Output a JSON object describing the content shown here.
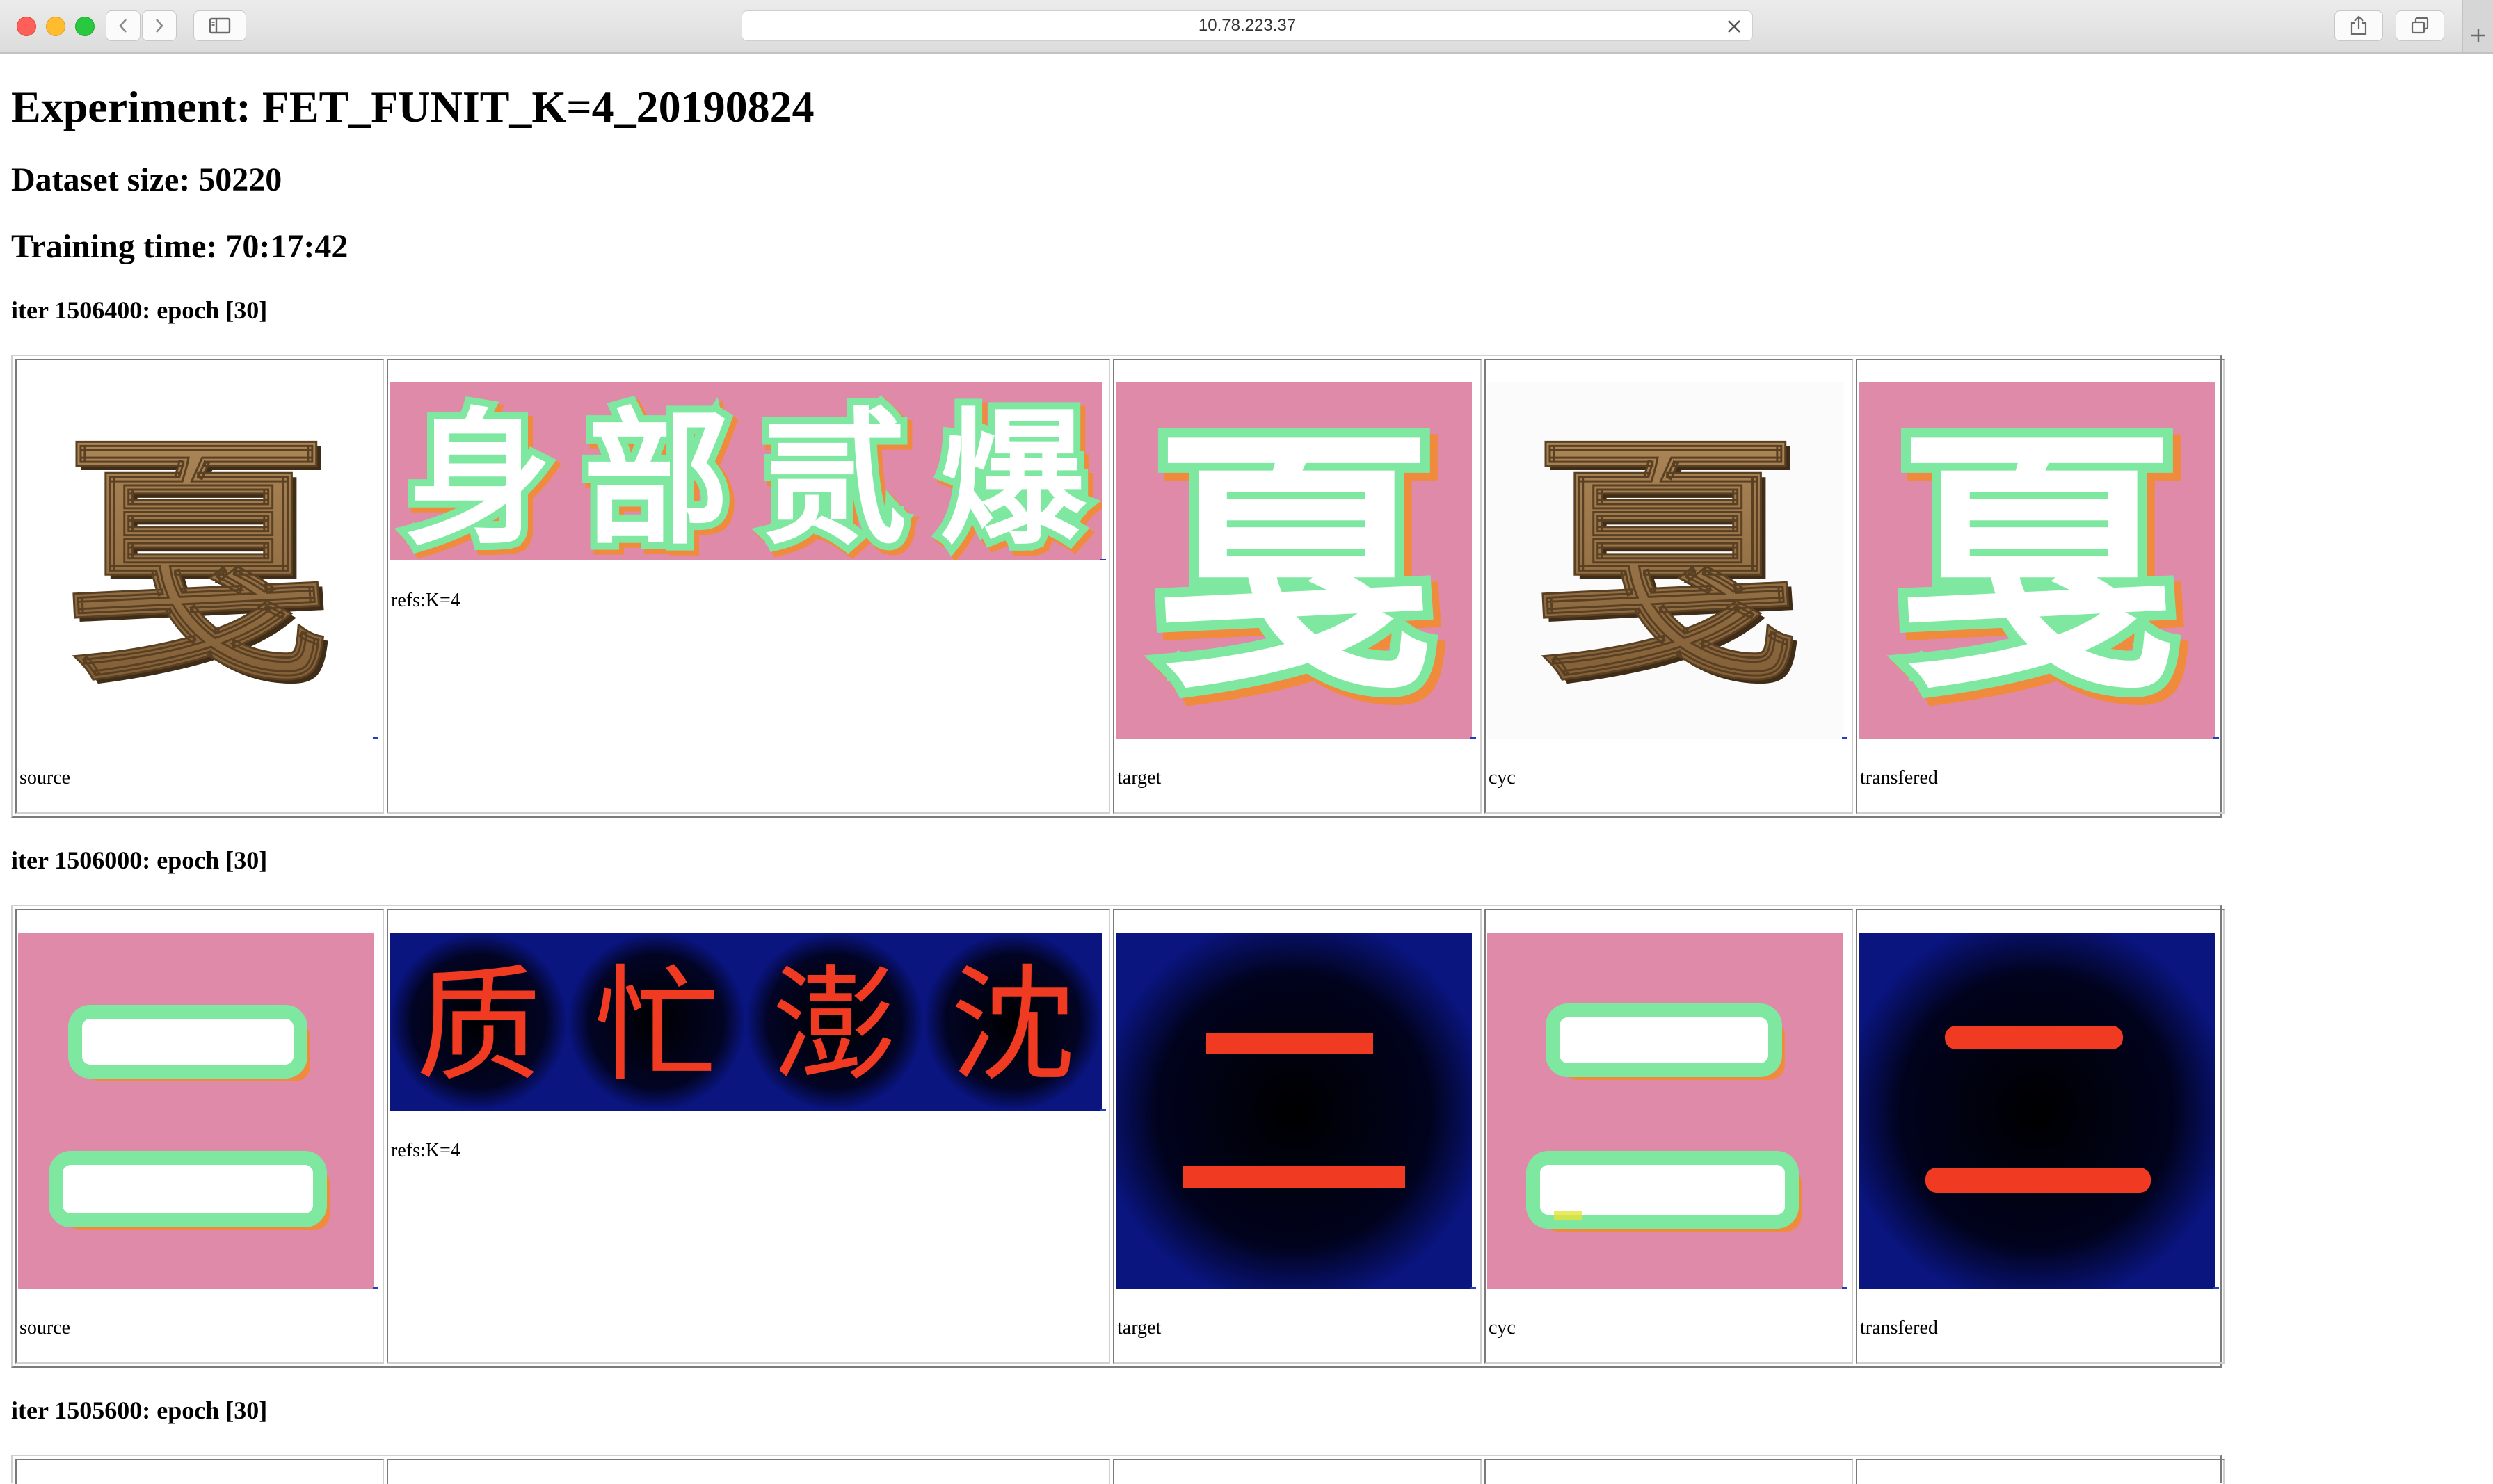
{
  "browser": {
    "url": "10.78.223.37"
  },
  "page": {
    "experiment_title": "Experiment: FET_FUNIT_K=4_20190824",
    "dataset_size": "Dataset size: 50220",
    "training_time": "Training time: 70:17:42"
  },
  "iterations": [
    {
      "label": "iter 1506400: epoch [30]",
      "source_caption": "source",
      "refs_caption": "refs:K=4",
      "target_caption": "target",
      "cyc_caption": "cyc",
      "transfered_caption": "transfered",
      "source_glyph": "戛",
      "ref_glyphs": [
        "身",
        "部",
        "贰",
        "爆"
      ],
      "target_glyph": "戛",
      "cyc_glyph": "戛",
      "transfered_glyph": "戛"
    },
    {
      "label": "iter 1506000: epoch [30]",
      "source_caption": "source",
      "refs_caption": "refs:K=4",
      "target_caption": "target",
      "cyc_caption": "cyc",
      "transfered_caption": "transfered",
      "source_glyph": "二",
      "ref_glyphs": [
        "质",
        "忙",
        "澎",
        "沈"
      ],
      "target_glyph": "二",
      "cyc_glyph": "二",
      "transfered_glyph": "二"
    },
    {
      "label": "iter 1505600: epoch [30]"
    }
  ],
  "colors": {
    "pink_bg": "#e08aaa",
    "navy_bg": "#050a4a",
    "mint_outline": "#7ee8a0",
    "orange_shadow": "#f08a3c",
    "bronze": "#9a7446",
    "neon_red": "#f03a22"
  }
}
